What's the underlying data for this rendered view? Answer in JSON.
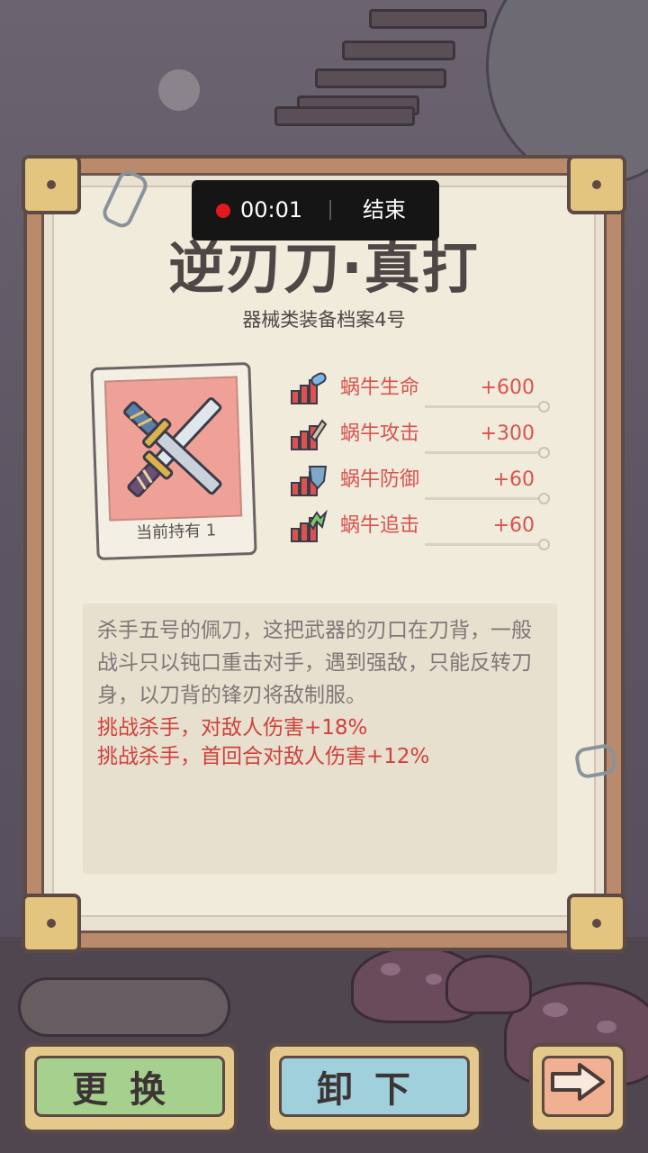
{
  "recording": {
    "time": "00:01",
    "end_label": "结束"
  },
  "item": {
    "name": "逆刃刀·真打",
    "subtitle": "器械类装备档案4号",
    "owned_label": "当前持有  1",
    "stats": [
      {
        "icon": "health-icon",
        "name": "蜗牛生命",
        "value": "+600"
      },
      {
        "icon": "attack-icon",
        "name": "蜗牛攻击",
        "value": "+300"
      },
      {
        "icon": "defense-icon",
        "name": "蜗牛防御",
        "value": "+60"
      },
      {
        "icon": "pursuit-icon",
        "name": "蜗牛追击",
        "value": "+60"
      }
    ],
    "description": "杀手五号的佩刀，这把武器的刃口在刀背，一般战斗只以钝口重击对手，遇到强敌，只能反转刀身，以刀背的锋刃将敌制服。",
    "effects": [
      "挑战杀手，对敌人伤害+18%",
      "挑战杀手，首回合对敌人伤害+12%"
    ]
  },
  "buttons": {
    "change": "更换",
    "unequip": "卸下",
    "next_icon": "arrow-right-icon"
  },
  "colors": {
    "stat_red": "#d8534f",
    "effect_red": "#d0413c",
    "card_bg": "#f0a197"
  }
}
